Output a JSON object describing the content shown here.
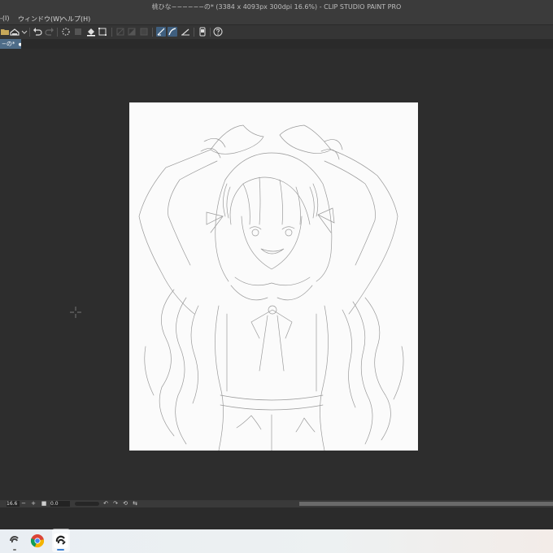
{
  "window": {
    "title": "桃ひな−−−−−−の* (3384 x 4093px 300dpi 16.6%)  - CLIP STUDIO PAINT PRO"
  },
  "menu": {
    "items": [
      {
        "label": "-(I)"
      },
      {
        "label": "ウィンドウ(W)"
      },
      {
        "label": "ヘルプ(H)"
      }
    ]
  },
  "toolbar": {
    "icons": [
      "open-folder-icon",
      "save-icon",
      "dropdown-icon",
      "undo-icon",
      "redo-icon",
      "loading-icon",
      "clear-icon",
      "fill-icon",
      "transform-icon",
      "hide-selection-icon",
      "fill-selection-icon",
      "invert-selection-icon",
      "snap-to-ruler-icon",
      "snap-to-special-ruler-icon",
      "snap-to-grid-icon",
      "device-icon",
      "help-icon"
    ]
  },
  "tab": {
    "label": "−の*",
    "close_mark": "●"
  },
  "status": {
    "zoom": "16.6",
    "minus": "−",
    "plus": "+",
    "angle": "0.0"
  },
  "taskbar": {
    "apps": [
      {
        "icon": "clip-studio-icon"
      },
      {
        "icon": "chrome-icon"
      },
      {
        "icon": "clip-studio-paint-icon"
      }
    ]
  },
  "colors": {
    "accent": "#4e6c88",
    "canvas_bg": "#2d2d2d",
    "paper": "#fbfbfb"
  }
}
